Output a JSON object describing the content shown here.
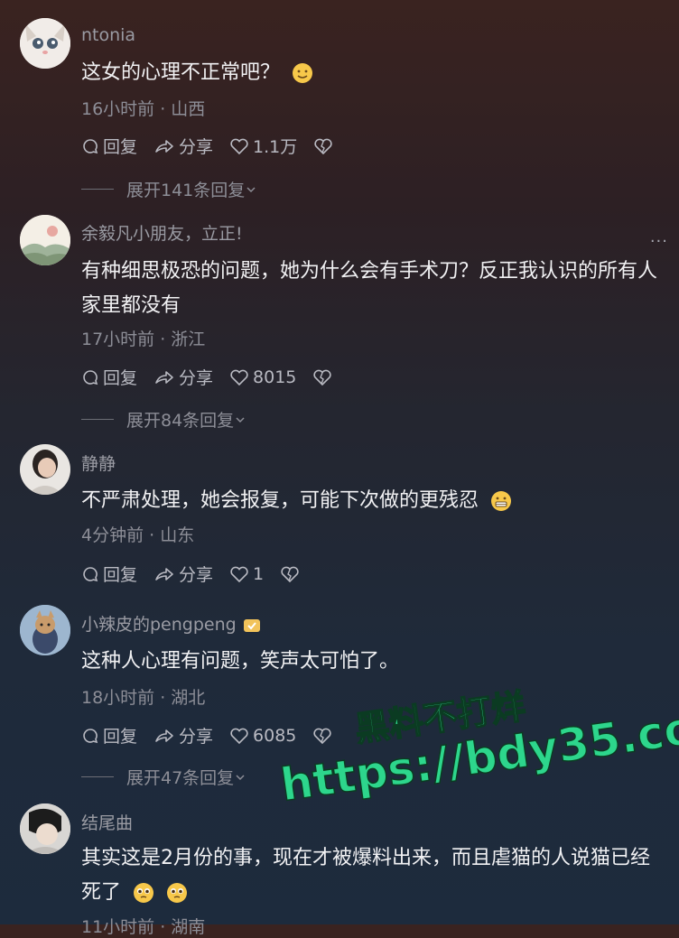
{
  "comments": [
    {
      "username": "ntonia",
      "text": "这女的心理不正常吧？",
      "emoji": "sweat-smile-emoji",
      "meta": "16小时前 · 山西",
      "reply": "回复",
      "share": "分享",
      "likes": "1.1万",
      "expand": "展开141条回复"
    },
    {
      "username": "余毅凡小朋友，立正!",
      "text": "有种细思极恐的问题，她为什么会有手术刀？反正我认识的所有人家里都没有",
      "meta": "17小时前 · 浙江",
      "reply": "回复",
      "share": "分享",
      "likes": "8015",
      "expand": "展开84条回复",
      "more": "..."
    },
    {
      "username": "静静",
      "text": "不严肃处理，她会报复，可能下次做的更残忍",
      "emoji": "grimace-emoji",
      "meta": "4分钟前 · 山东",
      "reply": "回复",
      "share": "分享",
      "likes": "1"
    },
    {
      "username": "小辣皮的pengpeng",
      "username_badge": "badge-icon",
      "text": "这种人心理有问题，笑声太可怕了。",
      "meta": "18小时前 · 湖北",
      "reply": "回复",
      "share": "分享",
      "likes": "6085",
      "expand": "展开47条回复"
    },
    {
      "username": "结尾曲",
      "text": "其实这是2月份的事，现在才被爆料出来，而且虐猫的人说猫已经死了",
      "emoji": "pleading-emoji",
      "meta": "11小时前 · 湖南"
    }
  ],
  "watermark": {
    "line1": "黑料不打烊",
    "line2": "https://bdy35.co"
  }
}
